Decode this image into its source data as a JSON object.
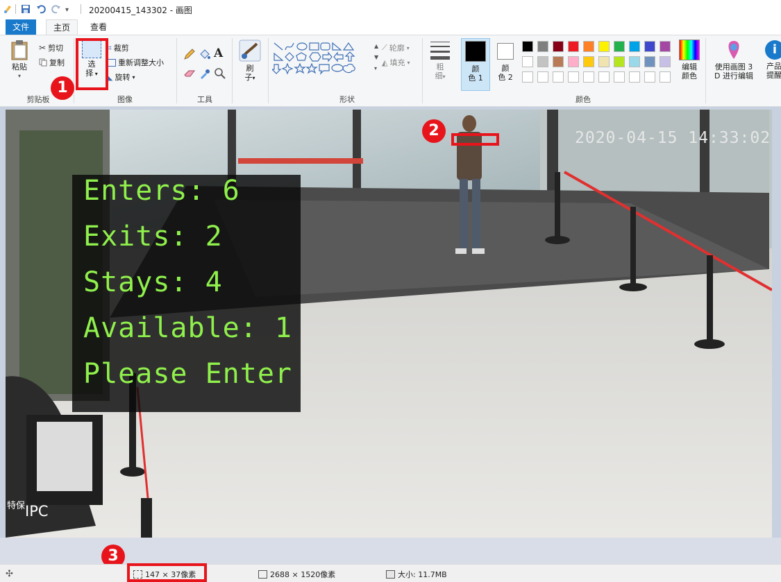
{
  "window": {
    "title": "20200415_143302 - 画图"
  },
  "tabs": [
    {
      "label": "文件"
    },
    {
      "label": "主页"
    },
    {
      "label": "查看"
    }
  ],
  "ribbon": {
    "clipboard": {
      "paste": "粘贴",
      "cut": "剪切",
      "copy": "复制",
      "group": "剪贴板"
    },
    "image": {
      "select_top": "选",
      "select_bottom": "择",
      "crop": "裁剪",
      "resize": "重新调整大小",
      "rotate": "旋转",
      "group": "图像"
    },
    "tools": {
      "group": "工具",
      "text_icon": "A"
    },
    "brush": {
      "label_top": "刷",
      "label_bottom": "子"
    },
    "shapes": {
      "outline": "轮廓",
      "fill": "填充",
      "group": "形状"
    },
    "size": {
      "label_top": "粗",
      "label_bottom": "细"
    },
    "color1": {
      "label_top": "颜",
      "label_bottom": "色 1"
    },
    "color2": {
      "label_top": "颜",
      "label_bottom": "色 2"
    },
    "colors": {
      "group": "颜色",
      "edit_top": "编辑",
      "edit_bottom": "颜色"
    },
    "paint3d": {
      "top": "使用画图 3",
      "bottom": "D 进行编辑"
    },
    "product": {
      "top": "产品",
      "bottom": "提醒"
    },
    "palette": [
      "#000000",
      "#7f7f7f",
      "#880015",
      "#ed1c24",
      "#ff7f27",
      "#fff200",
      "#22b14c",
      "#00a2e8",
      "#3f48cc",
      "#a349a4",
      "#ffffff",
      "#c3c3c3",
      "#b97a57",
      "#ffaec9",
      "#ffc90e",
      "#efe4b0",
      "#b5e61d",
      "#99d9ea",
      "#7092be",
      "#c8bfe7",
      "#ffffff",
      "#ffffff",
      "#ffffff",
      "#ffffff",
      "#ffffff",
      "#ffffff",
      "#ffffff",
      "#ffffff",
      "#ffffff",
      "#ffffff"
    ]
  },
  "canvas": {
    "overlay_lines": [
      "Enters: 6",
      "Exits: 2",
      "Stays: 4",
      "Available: 1",
      "Please Enter"
    ],
    "timestamp": "2020-04-15 14:33:02",
    "camera_label": "IPC",
    "camera_label_cn": "特保"
  },
  "annotations": {
    "badge1": "1",
    "badge2": "2",
    "badge3": "3"
  },
  "status": {
    "selection_size": "147 × 37像素",
    "image_size": "2688 × 1520像素",
    "file_size": "大小: 11.7MB"
  },
  "colors": {
    "accent": "#1979ca",
    "highlight_red": "#e8141c",
    "overlay_text": "#8ff04c"
  }
}
